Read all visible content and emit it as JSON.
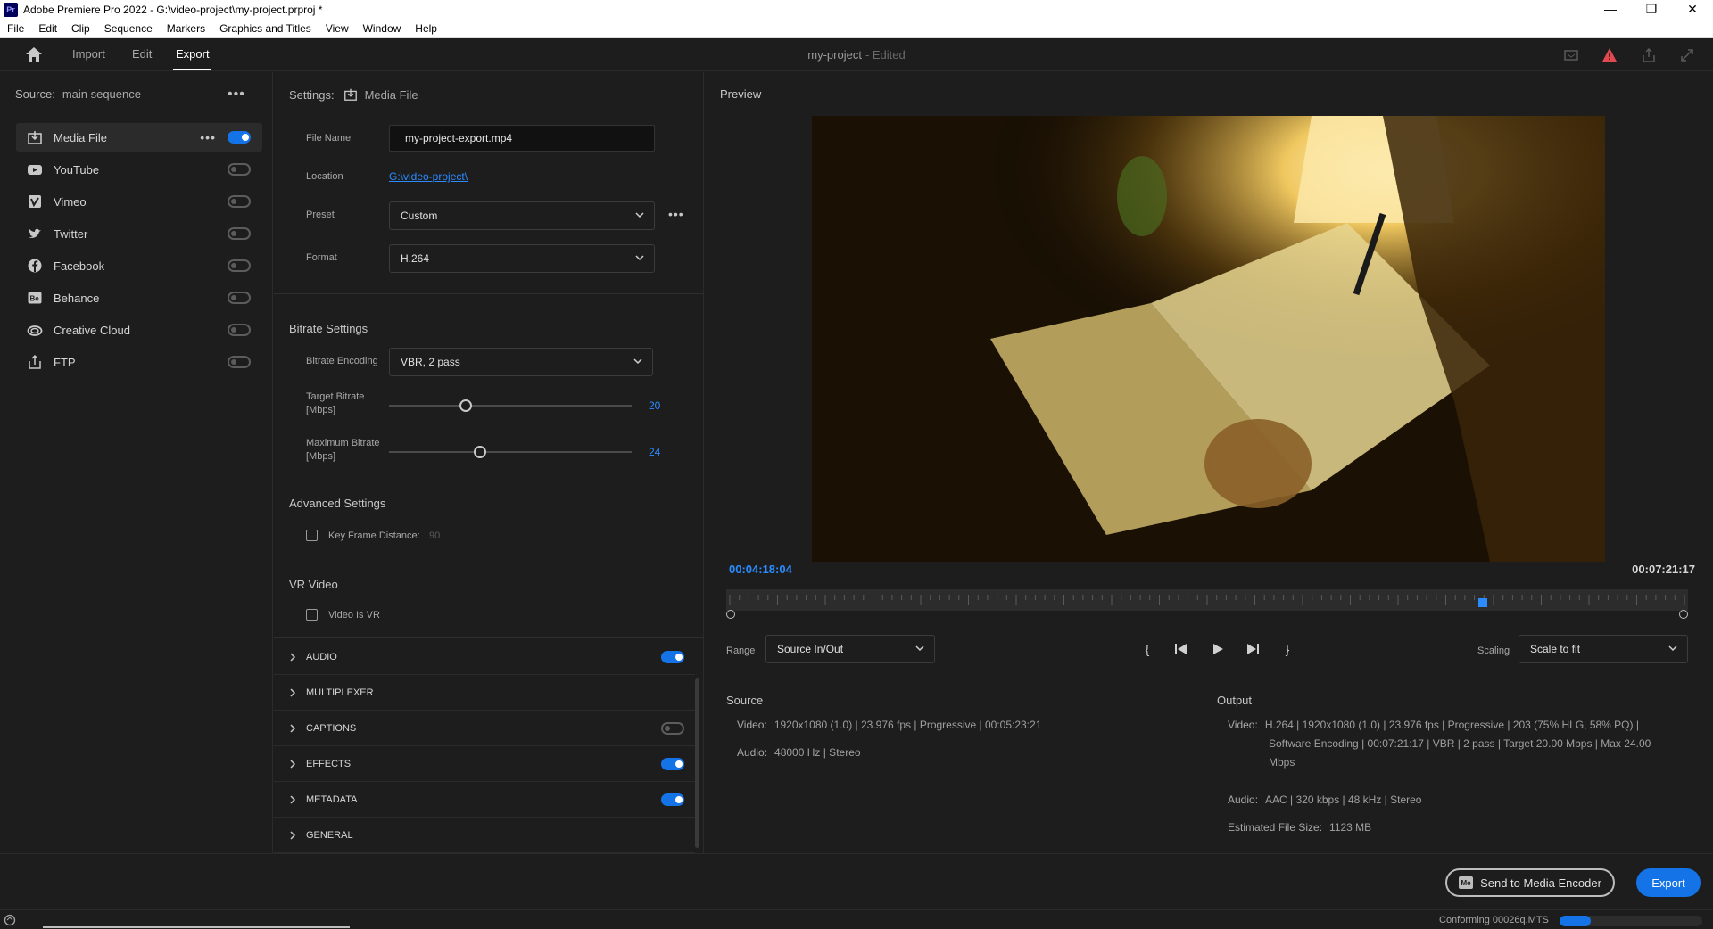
{
  "window": {
    "title": "Adobe Premiere Pro 2022 - G:\\video-project\\my-project.prproj *",
    "logo": "Pr"
  },
  "menu": [
    "File",
    "Edit",
    "Clip",
    "Sequence",
    "Markers",
    "Graphics and Titles",
    "View",
    "Window",
    "Help"
  ],
  "header": {
    "tabs": [
      "Import",
      "Edit",
      "Export"
    ],
    "active_tab": "Export",
    "project": "my-project",
    "status": "- Edited"
  },
  "source": {
    "label": "Source:",
    "value": "main sequence"
  },
  "destinations": [
    {
      "label": "Media File",
      "icon": "media-file-icon",
      "enabled": true
    },
    {
      "label": "YouTube",
      "icon": "youtube-icon",
      "enabled": false
    },
    {
      "label": "Vimeo",
      "icon": "vimeo-icon",
      "enabled": false
    },
    {
      "label": "Twitter",
      "icon": "twitter-icon",
      "enabled": false
    },
    {
      "label": "Facebook",
      "icon": "facebook-icon",
      "enabled": false
    },
    {
      "label": "Behance",
      "icon": "behance-icon",
      "enabled": false
    },
    {
      "label": "Creative Cloud",
      "icon": "creative-cloud-icon",
      "enabled": false
    },
    {
      "label": "FTP",
      "icon": "ftp-icon",
      "enabled": false
    }
  ],
  "settings": {
    "label": "Settings:",
    "target": "Media File",
    "file_name_label": "File Name",
    "file_name": "my-project-export.mp4",
    "location_label": "Location",
    "location": "G:\\video-project\\",
    "preset_label": "Preset",
    "preset": "Custom",
    "format_label": "Format",
    "format": "H.264"
  },
  "bitrate": {
    "title": "Bitrate Settings",
    "encoding_label": "Bitrate Encoding",
    "encoding": "VBR, 2 pass",
    "target_label": "Target Bitrate",
    "target_unit": "[Mbps]",
    "target_value": "20",
    "max_label": "Maximum Bitrate",
    "max_unit": "[Mbps]",
    "max_value": "24"
  },
  "advanced": {
    "title": "Advanced Settings",
    "keyframe_label": "Key Frame Distance:",
    "keyframe_value": "90"
  },
  "vr": {
    "title": "VR Video",
    "label": "Video Is VR"
  },
  "sections": [
    {
      "label": "AUDIO",
      "toggle": "on"
    },
    {
      "label": "MULTIPLEXER",
      "toggle": "none"
    },
    {
      "label": "CAPTIONS",
      "toggle": "off"
    },
    {
      "label": "EFFECTS",
      "toggle": "on"
    },
    {
      "label": "METADATA",
      "toggle": "on"
    },
    {
      "label": "GENERAL",
      "toggle": "none"
    }
  ],
  "preview": {
    "title": "Preview",
    "current_time": "00:04:18:04",
    "duration": "00:07:21:17",
    "range_label": "Range",
    "range": "Source In/Out",
    "scaling_label": "Scaling",
    "scaling": "Scale to fit",
    "playhead_fraction": 0.787
  },
  "source_info": {
    "title": "Source",
    "video_label": "Video:",
    "video": "1920x1080 (1.0)  |  23.976 fps  |  Progressive  |  00:05:23:21",
    "audio_label": "Audio:",
    "audio": "48000 Hz  |  Stereo"
  },
  "output_info": {
    "title": "Output",
    "video_label": "Video:",
    "video_line1": "H.264  |  1920x1080 (1.0)  |  23.976 fps  |  Progressive  |  203 (75% HLG, 58% PQ)  |",
    "video_line2": "Software Encoding  |  00:07:21:17  |  VBR  |  2 pass  |  Target 20.00 Mbps  |  Max 24.00",
    "video_line3": "Mbps",
    "audio_label": "Audio:",
    "audio": "AAC  |  320 kbps  |  48 kHz  |  Stereo",
    "size_label": "Estimated File Size:",
    "size": "1123 MB"
  },
  "footer": {
    "send_label": "Send to Media Encoder",
    "send_icon_text": "Me",
    "export_label": "Export"
  },
  "status": {
    "text": "Conforming 00026q.MTS",
    "progress": 0.22
  },
  "colors": {
    "accent": "#1473e6",
    "link": "#2a8cff",
    "background": "#1d1d1d",
    "warning": "#e34850"
  }
}
